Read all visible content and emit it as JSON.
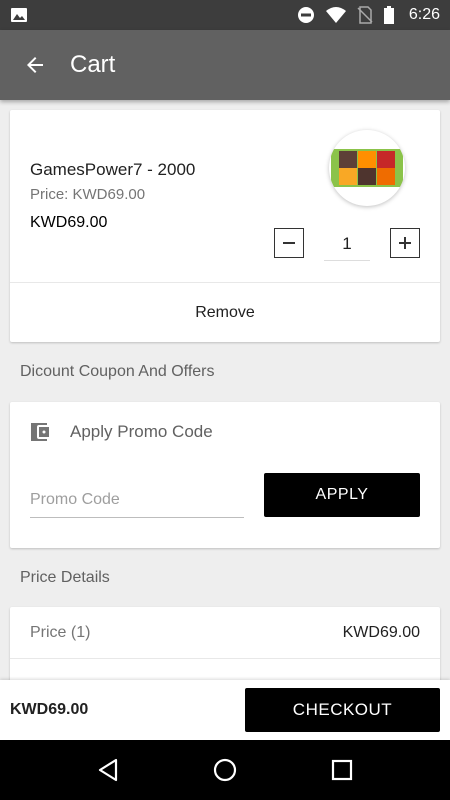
{
  "status_bar": {
    "time": "6:26",
    "icons": [
      "image-icon",
      "dnd-icon",
      "wifi-icon",
      "no-sim-icon",
      "battery-icon"
    ]
  },
  "app_bar": {
    "title": "Cart",
    "back_icon": "arrow-back-icon"
  },
  "cart_item": {
    "name": "GamesPower7 - 2000",
    "price_label": "Price: KWD69.00",
    "total": "KWD69.00",
    "quantity": "1",
    "remove_label": "Remove"
  },
  "coupon_section": {
    "label": "Dicount Coupon And Offers"
  },
  "promo": {
    "title": "Apply Promo Code",
    "placeholder": "Promo Code",
    "value": "",
    "apply_label": "APPLY"
  },
  "price_details": {
    "label": "Price Details",
    "rows": [
      {
        "label": "Price (1)",
        "value": "KWD69.00"
      }
    ]
  },
  "bottom_bar": {
    "total": "KWD69.00",
    "checkout_label": "CHECKOUT"
  },
  "colors": {
    "app_bar": "#616161",
    "status_bar": "#3d3d3d",
    "button": "#000000",
    "thumb_bg": "#8bc34a"
  }
}
